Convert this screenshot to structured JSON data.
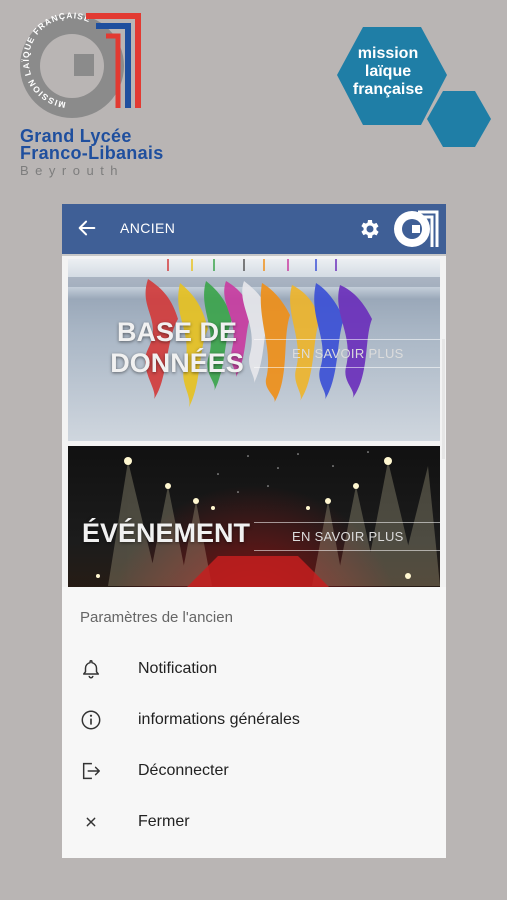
{
  "top_logos": {
    "glfl": {
      "ring_text": "MISSION LAÏQUE FRANÇAISE",
      "line1": "Grand Lycée",
      "line2": "Franco-Libanais",
      "line3": "Beyrouth"
    },
    "mlf": {
      "line1": "mission",
      "line2": "laïque",
      "line3": "française",
      "color": "#1f7ea6"
    }
  },
  "app": {
    "header": {
      "title": "ANCIEN",
      "color": "#3f5f96",
      "back_icon": "arrow-left-icon",
      "settings_icon": "gear-icon"
    },
    "cards": [
      {
        "title_line1": "BASE DE",
        "title_line2": "DONNÉES",
        "link": "EN SAVOIR PLUS"
      },
      {
        "title": "ÉVÉNEMENT",
        "link": "EN SAVOIR PLUS"
      }
    ]
  },
  "sheet": {
    "title": "Paramètres de l'ancien",
    "items": [
      {
        "label": "Notification",
        "icon": "bell-icon"
      },
      {
        "label": "informations générales",
        "icon": "info-icon"
      },
      {
        "label": "Déconnecter",
        "icon": "logout-icon"
      },
      {
        "label": "Fermer",
        "icon": "close-icon"
      }
    ]
  }
}
